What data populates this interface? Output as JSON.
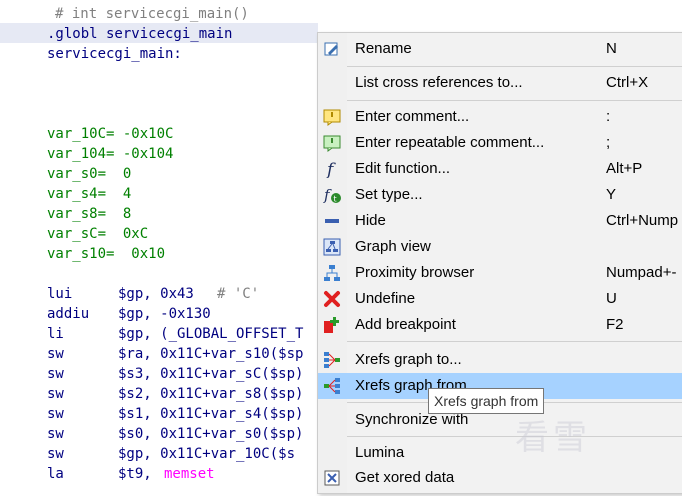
{
  "code": {
    "comment": "# int servicecgi_main()",
    "globl": ".globl servicecgi_main",
    "label": "servicecgi_main:",
    "vars": [
      {
        "text": "var_10C= -0x10C"
      },
      {
        "text": "var_104= -0x104"
      },
      {
        "text": "var_s0=  0"
      },
      {
        "text": "var_s4=  4"
      },
      {
        "text": "var_s8=  8"
      },
      {
        "text": "var_sC=  0xC"
      },
      {
        "text": "var_s10=  0x10"
      }
    ],
    "instructions": [
      {
        "mnemonic": "lui",
        "operands": "$gp, 0x43",
        "comment": "# 'C'"
      },
      {
        "mnemonic": "addiu",
        "operands": "$gp, -0x130",
        "comment": ""
      },
      {
        "mnemonic": "li",
        "operands": "$gp, (_GLOBAL_OFFSET_T",
        "comment": ""
      },
      {
        "mnemonic": "sw",
        "operands": "$ra, 0x11C+var_s10($sp",
        "comment": ""
      },
      {
        "mnemonic": "sw",
        "operands": "$s3, 0x11C+var_sC($sp)",
        "comment": ""
      },
      {
        "mnemonic": "sw",
        "operands": "$s2, 0x11C+var_s8($sp)",
        "comment": ""
      },
      {
        "mnemonic": "sw",
        "operands": "$s1, 0x11C+var_s4($sp)",
        "comment": ""
      },
      {
        "mnemonic": "sw",
        "operands": "$s0, 0x11C+var_s0($sp)",
        "comment": ""
      },
      {
        "mnemonic": "sw",
        "operands": "$gp, 0x11C+var_10C($s",
        "comment": ""
      },
      {
        "mnemonic": "la",
        "operands": "$t9, ",
        "symbol": "memset",
        "comment": ""
      }
    ]
  },
  "menu": {
    "items": [
      {
        "label": "Rename",
        "shortcut": "N",
        "icon": "rename-icon"
      },
      {
        "label": "List cross references to...",
        "shortcut": "Ctrl+X",
        "icon": ""
      },
      {
        "label": "Enter comment...",
        "shortcut": ":",
        "icon": "comment-icon"
      },
      {
        "label": "Enter repeatable comment...",
        "shortcut": ";",
        "icon": "repeatable-comment-icon"
      },
      {
        "label": "Edit function...",
        "shortcut": "Alt+P",
        "icon": "function-icon"
      },
      {
        "label": "Set type...",
        "shortcut": "Y",
        "icon": "set-type-icon"
      },
      {
        "label": "Hide",
        "shortcut": "Ctrl+Nump",
        "icon": "hide-icon"
      },
      {
        "label": "Graph view",
        "shortcut": "",
        "icon": "graph-view-icon"
      },
      {
        "label": "Proximity browser",
        "shortcut": "Numpad+-",
        "icon": "proximity-icon"
      },
      {
        "label": "Undefine",
        "shortcut": "U",
        "icon": "undefine-icon"
      },
      {
        "label": "Add breakpoint",
        "shortcut": "F2",
        "icon": "breakpoint-icon"
      },
      {
        "label": "Xrefs graph to...",
        "shortcut": "",
        "icon": "xrefs-to-icon"
      },
      {
        "label": "Xrefs graph from",
        "shortcut": "",
        "icon": "xrefs-from-icon"
      },
      {
        "label": "Synchronize with",
        "shortcut": "",
        "icon": ""
      },
      {
        "label": "Lumina",
        "shortcut": "",
        "icon": ""
      },
      {
        "label": "Get xored data",
        "shortcut": "",
        "icon": "xored-icon"
      }
    ]
  },
  "tooltip": {
    "text": "Xrefs graph from"
  },
  "watermark": {
    "text": "看雪"
  },
  "colors": {
    "highlight": "#a6d2ff",
    "code_blue": "#000080",
    "code_green": "#008000",
    "code_pink": "#ff00ff"
  }
}
